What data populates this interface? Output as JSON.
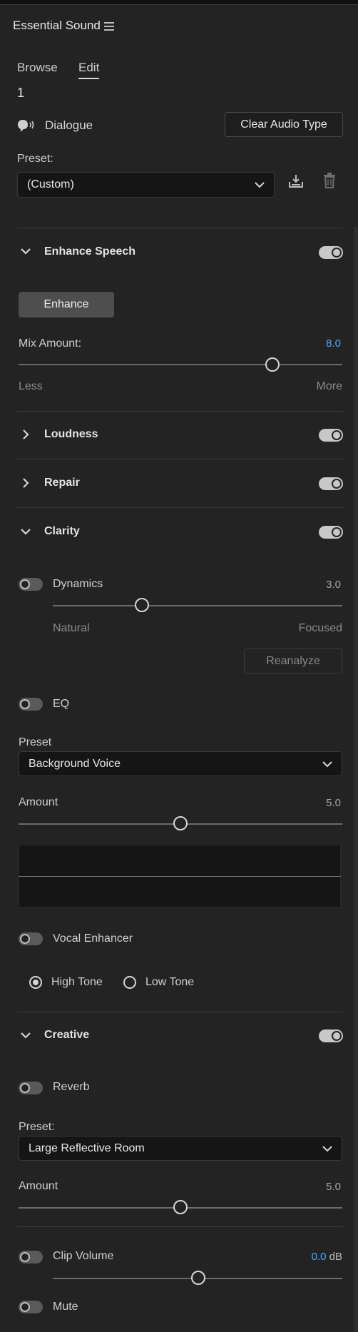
{
  "panel": {
    "title": "Essential Sound"
  },
  "tabs": [
    {
      "label": "Browse"
    },
    {
      "label": "Edit",
      "active": true
    }
  ],
  "clip_number": "1",
  "audio_type": {
    "label": "Dialogue",
    "clear_button": "Clear Audio Type"
  },
  "preset": {
    "label": "Preset:",
    "value": "(Custom)"
  },
  "enhance_speech": {
    "title": "Enhance Speech",
    "enabled": true,
    "button": "Enhance",
    "mix_label": "Mix Amount:",
    "mix_value": "8.0",
    "mix_fraction": 0.8,
    "min_label": "Less",
    "max_label": "More"
  },
  "loudness": {
    "title": "Loudness",
    "enabled": true
  },
  "repair": {
    "title": "Repair",
    "enabled": true
  },
  "clarity": {
    "title": "Clarity",
    "enabled": true,
    "dynamics": {
      "label": "Dynamics",
      "enabled": false,
      "value": "3.0",
      "fraction": 0.3,
      "min_label": "Natural",
      "max_label": "Focused",
      "reanalyze": "Reanalyze"
    },
    "eq": {
      "label": "EQ",
      "enabled": false,
      "preset_label": "Preset",
      "preset_value": "Background Voice",
      "amount_label": "Amount",
      "amount_value": "5.0",
      "amount_fraction": 0.5
    },
    "vocal_enhancer": {
      "label": "Vocal Enhancer",
      "enabled": false,
      "options": [
        {
          "label": "High Tone",
          "selected": true
        },
        {
          "label": "Low Tone",
          "selected": false
        }
      ]
    }
  },
  "creative": {
    "title": "Creative",
    "enabled": true,
    "reverb": {
      "label": "Reverb",
      "enabled": false,
      "preset_label": "Preset:",
      "preset_value": "Large Reflective Room",
      "amount_label": "Amount",
      "amount_value": "5.0",
      "amount_fraction": 0.5
    }
  },
  "clip_volume": {
    "label": "Clip Volume",
    "enabled": false,
    "value": "0.0",
    "unit": "dB",
    "fraction": 0.5
  },
  "mute": {
    "label": "Mute",
    "enabled": false
  },
  "colors": {
    "background": "#232323",
    "accent_blue": "#4aa8ff"
  }
}
